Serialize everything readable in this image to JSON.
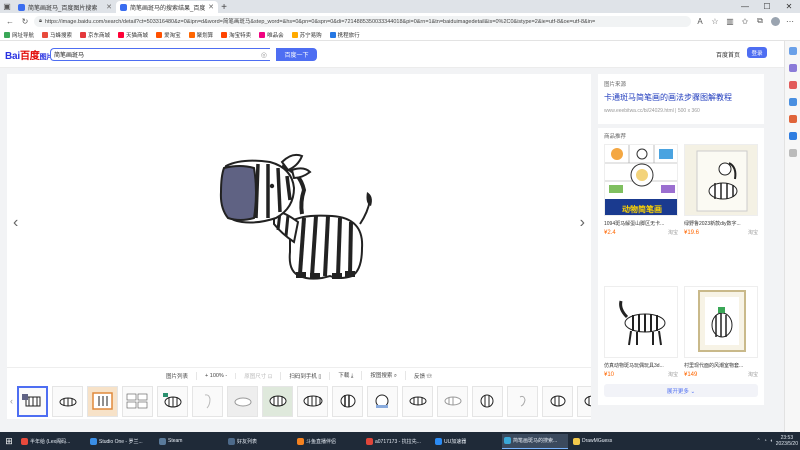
{
  "browser": {
    "tabs": [
      {
        "title": "简笔画斑马_百度图片搜索",
        "active": false
      },
      {
        "title": "简笔画斑马的搜索结果_百度图片",
        "active": true
      }
    ],
    "url": "https://image.baidu.com/search/detail?ct=503316480&z=0&ipn=d&word=简笔画斑马&step_word=&hs=0&pn=0&spn=0&di=7214885350033344018&pi=0&rn=1&tn=baiduimagedetail&is=0%2C0&istype=2&ie=utf-8&oe=utf-8&in=",
    "bookmarks": [
      "网址导航",
      "马蜂搜索",
      "京东商城",
      "天猫商城",
      "爱淘宝",
      "聚划算",
      "淘宝特卖",
      "唯品会",
      "苏宁易购",
      "携程旅行"
    ]
  },
  "header": {
    "logo_text": "Bai百度图片",
    "search_value": "简笔画斑马",
    "search_button": "百度一下",
    "home_link": "百度首页",
    "login": "登录"
  },
  "toolbar": {
    "items": [
      {
        "label": "图片列表",
        "icon": "grid",
        "disabled": false
      },
      {
        "label": "+   100%   -",
        "icon": "",
        "disabled": false
      },
      {
        "label": "原图尺寸 ⊡",
        "icon": "",
        "disabled": true
      },
      {
        "label": "扫码到手机 ▯",
        "icon": "",
        "disabled": false
      },
      {
        "label": "下载 ⤓",
        "icon": "",
        "disabled": false
      },
      {
        "label": "按图搜索 ⌕",
        "icon": "",
        "disabled": false
      },
      {
        "label": "反馈 ☏",
        "icon": "",
        "disabled": false
      }
    ]
  },
  "source": {
    "label": "图片来源",
    "title": "卡通斑马简笔画的画法步骤图解教程",
    "site": "www.eeebitwa.cc/bi/24029.html  |  500 x 360"
  },
  "recommend": {
    "label": "商品推荐",
    "products": [
      {
        "name": "1094斑马解蛋山脚区无卡...",
        "price": "¥2.4",
        "shop": "淘宝"
      },
      {
        "name": "绿野鲁2023新款diy数字...",
        "price": "¥19.6",
        "shop": "淘宝"
      },
      {
        "name": "仿真动物斑马玩偶玩具3d...",
        "price": "¥10",
        "shop": "淘宝"
      },
      {
        "name": "村里现代面的风潮室物套...",
        "price": "¥149",
        "shop": "淘宝"
      }
    ],
    "more": "展开更多 ⌄"
  },
  "taskbar": {
    "apps": [
      {
        "label": "半年给 (Lex阁码...",
        "color": "#e84a3c"
      },
      {
        "label": "Studio One - 罗兰...",
        "color": "#3a8ee6"
      },
      {
        "label": "Steam",
        "color": "#1b2838"
      },
      {
        "label": "好友列表",
        "color": "#4d6a8a"
      },
      {
        "label": "斗鱼直播伴侣",
        "color": "#f58220"
      },
      {
        "label": "a0717173 - 抗拉先...",
        "color": "#e0463a"
      },
      {
        "label": "UU加速器",
        "color": "#2c8cf4"
      },
      {
        "label": "简笔画斑马的搜索...",
        "color": "#3aa8d8"
      },
      {
        "label": "DrawMGuess",
        "color": "#f2c94c"
      }
    ],
    "time": "23:53",
    "date": "2023/5/20"
  },
  "colors": {
    "accent": "#4e6ef2",
    "price": "#ff6600",
    "link": "#1f3bbd"
  }
}
